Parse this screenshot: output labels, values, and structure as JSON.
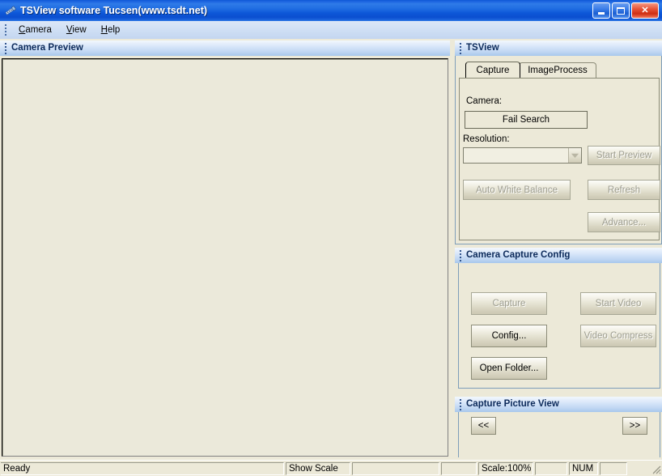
{
  "window": {
    "title": "TSView software Tucsen(www.tsdt.net)",
    "icon": "app-icon",
    "buttons": {
      "minimize": "minimize-icon",
      "maximize": "maximize-icon",
      "close": "✕"
    }
  },
  "menubar": {
    "items": [
      {
        "label": "Camera",
        "mnemonic": "C"
      },
      {
        "label": "View",
        "mnemonic": "V"
      },
      {
        "label": "Help",
        "mnemonic": "H"
      }
    ]
  },
  "left_pane": {
    "header": "Camera Preview"
  },
  "right_pane": {
    "tsview": {
      "header": "TSView",
      "tabs": [
        {
          "label": "Capture",
          "active": true
        },
        {
          "label": "ImageProcess",
          "active": false
        }
      ],
      "camera_label": "Camera:",
      "camera_status": "Fail Search",
      "resolution_label": "Resolution:",
      "resolution_value": "",
      "resolution_placeholder": "",
      "buttons": [
        {
          "label": "Start Preview",
          "enabled": false
        },
        {
          "label": "Auto White Balance",
          "enabled": false
        },
        {
          "label": "Refresh",
          "enabled": false
        },
        {
          "label": "Advance...",
          "enabled": false
        }
      ]
    },
    "capture_config": {
      "header": "Camera Capture Config",
      "buttons": [
        {
          "label": "Capture",
          "enabled": false
        },
        {
          "label": "Start Video",
          "enabled": false
        },
        {
          "label": "Config...",
          "enabled": true
        },
        {
          "label": "Video Compress",
          "enabled": false
        },
        {
          "label": "Open Folder...",
          "enabled": true
        }
      ]
    },
    "picture_view": {
      "header": "Capture Picture View",
      "prev_label": "<<",
      "next_label": ">>"
    }
  },
  "statusbar": {
    "message": "Ready",
    "show_scale": "Show Scale",
    "pane_blank_1": "",
    "pane_blank_2": "",
    "scale": "Scale:100%",
    "pane_blank_3": "",
    "num": "NUM",
    "pane_blank_4": ""
  },
  "colors": {
    "titlebar_blue": "#0b52d0",
    "panel_header_blue": "#bfd6f2",
    "face": "#ece9d8",
    "preview_bg": "#ebe9da",
    "disabled_text": "#9d9d8f",
    "close_red": "#cf2e13"
  }
}
